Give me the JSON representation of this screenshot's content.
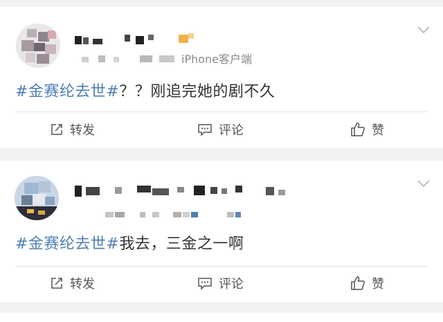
{
  "posts": [
    {
      "source": "iPhone客户端",
      "text": {
        "hashtag": "#金赛纶去世#",
        "rest": "？？刚追完她的剧不久"
      },
      "actions": {
        "repost": "转发",
        "comment": "评论",
        "like": "赞"
      }
    },
    {
      "text": {
        "hashtag": "#金赛纶去世#",
        "rest": "我去，三金之一啊"
      },
      "actions": {
        "repost": "转发",
        "comment": "评论",
        "like": "赞"
      }
    }
  ],
  "icons": {
    "expand": "chevron-down-icon",
    "repost": "share-arrow-icon",
    "comment": "comment-bubble-icon",
    "like": "thumbs-up-icon"
  },
  "colors": {
    "hashtag": "#4f7fb3",
    "text": "#333333",
    "muted": "#8a8a8a",
    "background": "#f2f2f2"
  }
}
